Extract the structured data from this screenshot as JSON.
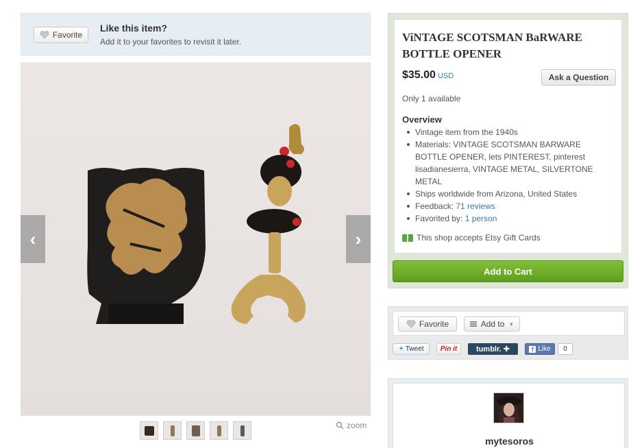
{
  "favorite_banner": {
    "button_label": "Favorite",
    "title": "Like this item?",
    "subtitle": "Add it to your favorites to revisit it later."
  },
  "gallery": {
    "zoom_label": "zoom",
    "thumbnail_count": 5
  },
  "listing": {
    "title": "ViNTAGE SCOTSMAN BaRWARE BOTTLE OPENER",
    "price": "$35.00",
    "currency": "USD",
    "ask_button": "Ask a Question",
    "availability": "Only 1 available",
    "overview_heading": "Overview",
    "overview": {
      "vintage": "Vintage item from the 1940s",
      "materials": "Materials: VINTAGE SCOTSMAN BARWARE BOTTLE OPENER, lets PINTEREST, pinterest lisadianesierra, VINTAGE METAL, SILVERTONE METAL",
      "ships": "Ships worldwide from Arizona, United States",
      "feedback_label": "Feedback: ",
      "feedback_link": "71 reviews",
      "favorited_label": "Favorited by: ",
      "favorited_link": "1 person"
    },
    "gift_cards": "This shop accepts Etsy Gift Cards",
    "cart_button": "Add to Cart"
  },
  "share": {
    "favorite_label": "Favorite",
    "add_to_label": "Add to",
    "tweet_label": "Tweet",
    "pinit_label": "Pin it",
    "tumblr_label": "tumblr.",
    "fb_like_label": "Like",
    "fb_count": "0"
  },
  "shop": {
    "name": "mytesoros"
  },
  "colors": {
    "cart_green": "#6aab28",
    "link_blue": "#3b76b0",
    "banner_blue": "#e6edf3"
  }
}
